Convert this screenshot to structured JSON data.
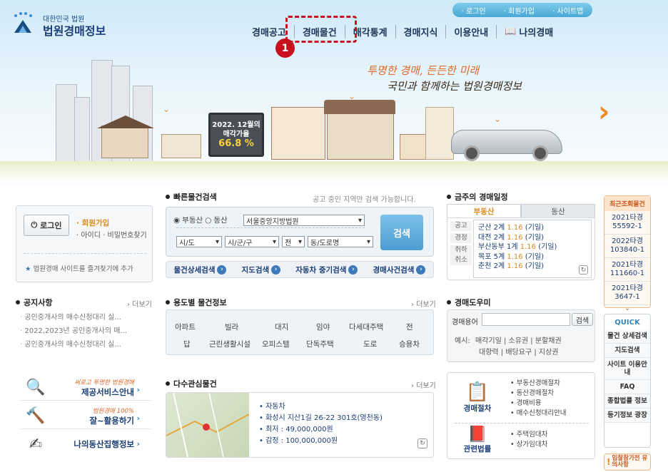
{
  "header": {
    "logo_small": "대한민국 법원",
    "logo_big": "법원경매정보",
    "top_links": [
      "· 로그인",
      "· 회원가입",
      "· 사이트맵"
    ],
    "gnb": [
      "경매공고",
      "경매물건",
      "매각통계",
      "경매지식",
      "이용안내",
      "나의경매"
    ],
    "step_badge": "1",
    "slogan_line1": "투명한 경매, 든든한 미래",
    "slogan_line2": "국민과 함께하는 법원경매정보",
    "billboard_line1": "2022. 12월의",
    "billboard_line2": "매각가율",
    "billboard_value": "66.8 %"
  },
  "login": {
    "login_button": "로그인",
    "join": "회원가입",
    "find": "아이디 · 비밀번호찾기",
    "favorite": "법원경매 사이트를 즐겨찾기에 추가"
  },
  "quick_search": {
    "title": "빠른물건검색",
    "note": "공고 중인 지역만 검색 가능합니다.",
    "radio_real_estate": "부동산",
    "radio_movable": "동산",
    "court": "서울중앙지방법원",
    "sido": "시/도",
    "sigungu": "시/군/구",
    "jeon": "전",
    "dong": "동/도로명",
    "search_button": "검색",
    "tabs": [
      "물건상세검색",
      "지도검색",
      "자동차 중기검색",
      "경매사건검색"
    ]
  },
  "notice": {
    "title": "공지사항",
    "more": "더보기",
    "items": [
      "공인중개사의 매수신청대리 실...",
      "2022,2023년 공인중개사의 매...",
      "공인중개사의 매수신청대리 실..."
    ]
  },
  "by_use": {
    "title": "용도별 물건정보",
    "more": "더보기",
    "row1": [
      "아파트",
      "빌라",
      "대지",
      "임야",
      "다세대주택",
      "전"
    ],
    "row2": [
      "답",
      "근린생활시설",
      "오피스텔",
      "단독주택",
      "도로",
      "승용차"
    ]
  },
  "schedule": {
    "title": "금주의 경매일정",
    "tab_active": "부동산",
    "tab_inactive": "동산",
    "side_labels": [
      "공고",
      "경정",
      "취하",
      "취소"
    ],
    "rows": [
      {
        "court": "군산",
        "count": "2계",
        "date": "1.16",
        "type": "(기일)"
      },
      {
        "court": "대전",
        "count": "2계",
        "date": "1.16",
        "type": "(기일)"
      },
      {
        "court": "부산동부",
        "count": "1계",
        "date": "1.16",
        "type": "(기일)"
      },
      {
        "court": "목포",
        "count": "5계",
        "date": "1.16",
        "type": "(기일)"
      },
      {
        "court": "춘천",
        "count": "2계",
        "date": "1.16",
        "type": "(기일)"
      }
    ]
  },
  "helper": {
    "title": "경매도우미",
    "term_label": "경매용어",
    "search_button": "검색",
    "example_label": "예시:",
    "examples_row1": [
      "매각기일",
      "소유권",
      "분할채권"
    ],
    "examples_row2": [
      "대항력",
      "배당요구",
      "지상권"
    ]
  },
  "services": [
    {
      "caption": "써로고 투명한 법원경매",
      "label": "제공서비스안내"
    },
    {
      "caption": "법원경매 100%",
      "label": "잘~활용하기"
    },
    {
      "caption": "",
      "label": "나의동산집행정보"
    }
  ],
  "interest": {
    "title": "다수관심물건",
    "more": "더보기",
    "lines": [
      "자동차",
      "화성시 지산1길 26-22 301호(영천동)",
      "최저 : 49,000,000원",
      "감정 : 100,000,000원"
    ]
  },
  "procedure": {
    "auction_label": "경매절차",
    "law_label": "관련법률",
    "auction_items": [
      "부동산경매절차",
      "동산경매절차",
      "경매비용",
      "매수신청대리안내"
    ],
    "law_items": [
      "주택임대차",
      "상가임대차"
    ]
  },
  "recent": {
    "title": "최근조회물건",
    "items": [
      "2021타경 55592-1",
      "2022타경 103840-1",
      "2021타경 111660-1",
      "2021타경 3647-1"
    ]
  },
  "quick": {
    "title": "QUICK",
    "items": [
      "물건 상세검색",
      "지도검색",
      "사이트 이용안내",
      "FAQ",
      "종합법률 정보",
      "등기정보 광장"
    ]
  },
  "caution": "입찰참가전 유의사항",
  "colors": {
    "accent": "#c8101e",
    "navy": "#1a3e77",
    "orange": "#e0881a",
    "search_blue": "#5aa8db"
  }
}
